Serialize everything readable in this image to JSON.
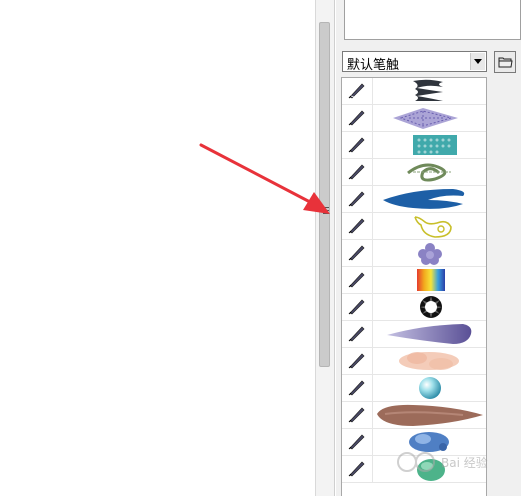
{
  "brush_panel": {
    "preset_select": {
      "selected": "默认笔触"
    },
    "brushes": [
      {
        "id": "b1",
        "name": "wave-lines-brush"
      },
      {
        "id": "b2",
        "name": "diamond-mesh-brush"
      },
      {
        "id": "b3",
        "name": "teal-dots-brush"
      },
      {
        "id": "b4",
        "name": "green-spiral-brush"
      },
      {
        "id": "b5",
        "name": "blue-ribbon-brush"
      },
      {
        "id": "b6",
        "name": "yellow-outline-brush"
      },
      {
        "id": "b7",
        "name": "lavender-flower-brush"
      },
      {
        "id": "b8",
        "name": "rainbow-gradient-brush"
      },
      {
        "id": "b9",
        "name": "black-star-brush"
      },
      {
        "id": "b10",
        "name": "purple-tapered-brush"
      },
      {
        "id": "b11",
        "name": "peach-cloud-brush"
      },
      {
        "id": "b12",
        "name": "blue-bubble-brush"
      },
      {
        "id": "b13",
        "name": "brown-tapered-brush"
      },
      {
        "id": "b14",
        "name": "blue-splash-brush"
      },
      {
        "id": "b15",
        "name": "green-blob-brush"
      }
    ]
  },
  "annotation": {
    "color": "#e8323a"
  },
  "colors": {
    "panel_bg": "#f0f0f0",
    "divider": "#cbcbcb"
  }
}
